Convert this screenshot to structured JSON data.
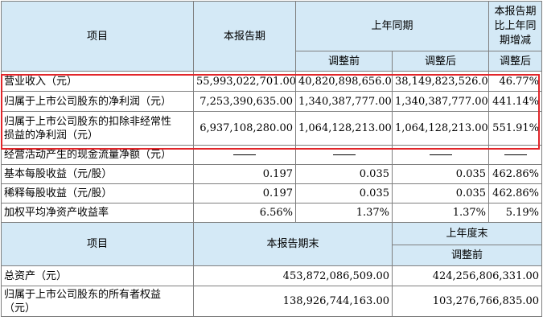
{
  "header": {
    "item": "项目",
    "current": "本报告期",
    "prior_year": "上年同期",
    "change_line1": "本报告期",
    "change_line2": "比上年同",
    "change_line3": "期增减",
    "before_adj": "调整前",
    "after_adj": "调整后",
    "change_adj": "调整后"
  },
  "rows": [
    {
      "label": "营业收入（元）",
      "current": "55,993,022,701.00",
      "before": "40,820,898,656.00",
      "after": "38,149,823,526.00",
      "change": "46.77%"
    },
    {
      "label": "归属于上市公司股东的净利润（元）",
      "current": "7,253,390,635.00",
      "before": "1,340,387,777.00",
      "after": "1,340,387,777.00",
      "change": "441.14%"
    },
    {
      "label_line1": "归属于上市公司股东的扣除非经常性",
      "label_line2": "损益的净利润（元）",
      "current": "6,937,108,280.00",
      "before": "1,064,128,213.00",
      "after": "1,064,128,213.00",
      "change": "551.91%"
    },
    {
      "label": "经营活动产生的现金流量净额（元）"
    },
    {
      "label": "基本每股收益（元/股）",
      "current": "0.197",
      "before": "0.035",
      "after": "0.035",
      "change": "462.86%"
    },
    {
      "label": "稀释每股收益（元/股）",
      "current": "0.197",
      "before": "0.035",
      "after": "0.035",
      "change": "462.86%"
    },
    {
      "label": "加权平均净资产收益率",
      "current": "6.56%",
      "before": "1.37%",
      "after": "1.37%",
      "change": "5.19%"
    }
  ],
  "header2": {
    "item": "项目",
    "period_end": "本报告期末",
    "prior_year_end": "上年度末",
    "before_adj": "调整前"
  },
  "rows2": [
    {
      "label": "总资产（元）",
      "period_end": "453,872,086,509.00",
      "prior": "424,256,806,331.00"
    },
    {
      "label_line1": "归属于上市公司股东的所有者权益",
      "label_line2": "（元）",
      "period_end": "138,926,744,163.00",
      "prior": "103,276,766,835.00"
    }
  ],
  "highlight_color": "#e2262a",
  "header_bg": "#d4e9f6"
}
